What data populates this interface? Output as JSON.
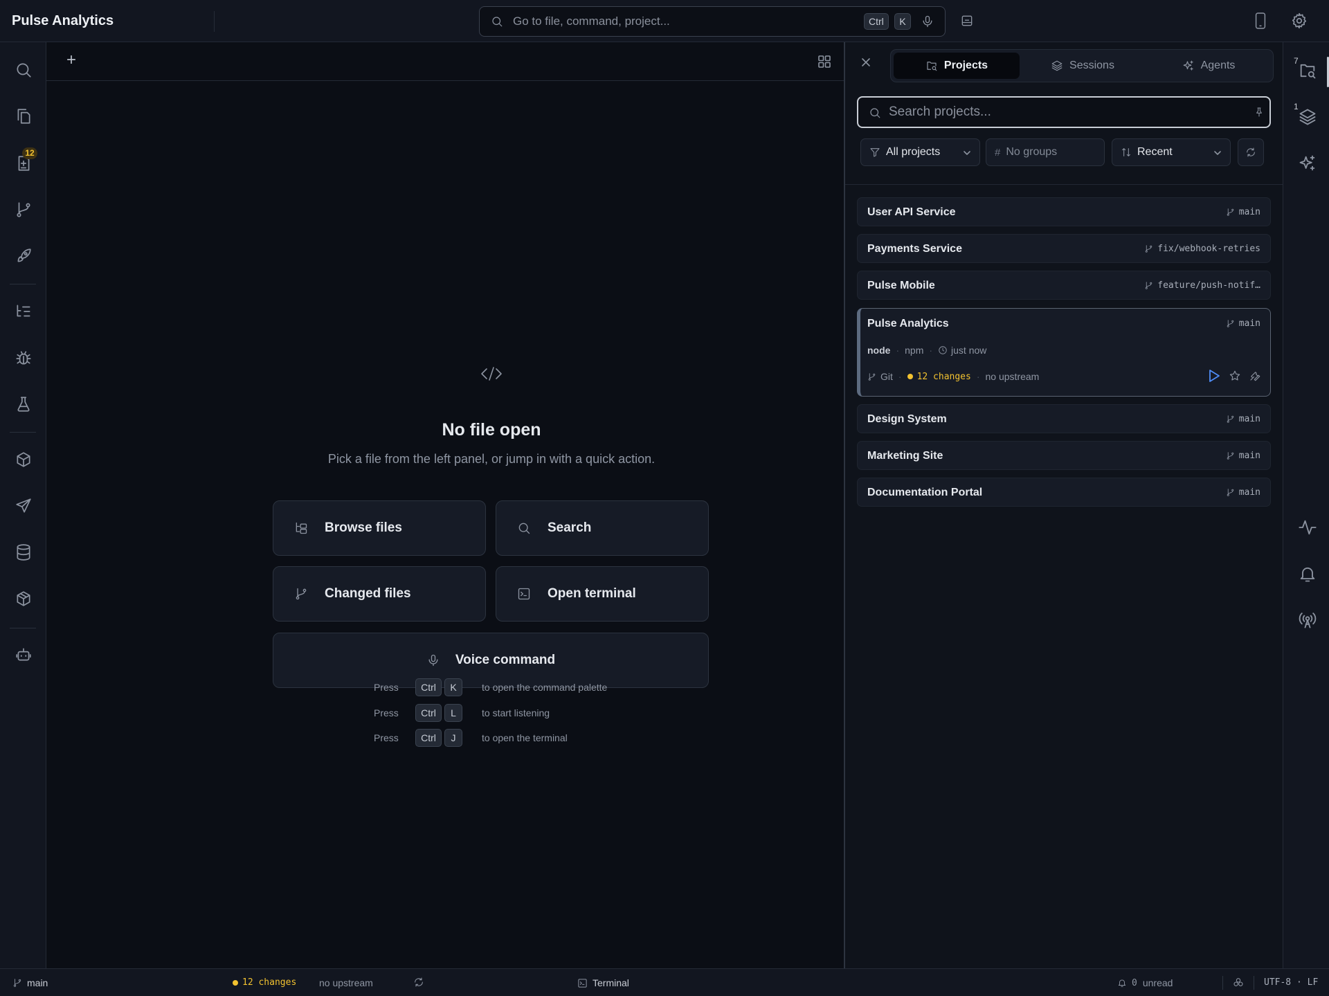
{
  "app": {
    "title": "Pulse Analytics"
  },
  "command_search": {
    "placeholder": "Go to file, command, project...",
    "shortcut_modifier": "Ctrl",
    "shortcut_key": "K"
  },
  "left_activity_bar": {
    "items": [
      {
        "icon": "search-icon"
      },
      {
        "icon": "files-icon"
      },
      {
        "icon": "changes-icon",
        "badge": "12"
      },
      {
        "icon": "git-branch-icon"
      },
      {
        "icon": "rocket-icon"
      },
      {
        "icon": "tasks-icon"
      },
      {
        "icon": "bug-icon"
      },
      {
        "icon": "flask-icon"
      },
      {
        "icon": "package-icon"
      },
      {
        "icon": "send-icon"
      },
      {
        "icon": "database-icon"
      },
      {
        "icon": "box-icon"
      },
      {
        "icon": "bot-icon"
      }
    ]
  },
  "editor": {
    "new_tab_label": "+",
    "empty_state": {
      "title": "No file open",
      "subtitle": "Pick a file from the left panel, or jump in with a quick action."
    },
    "quick_actions": {
      "browse": "Browse files",
      "search": "Search",
      "changed": "Changed files",
      "terminal": "Open terminal",
      "voice": "Voice command"
    },
    "hints": [
      {
        "press": "Press",
        "modifier": "Ctrl",
        "key": "K",
        "text": "to open the command palette"
      },
      {
        "press": "Press",
        "modifier": "Ctrl",
        "key": "L",
        "text": "to start listening"
      },
      {
        "press": "Press",
        "modifier": "Ctrl",
        "key": "J",
        "text": "to open the terminal"
      }
    ]
  },
  "panel": {
    "tabs": [
      {
        "label": "Projects",
        "active": true
      },
      {
        "label": "Sessions",
        "active": false
      },
      {
        "label": "Agents",
        "active": false
      }
    ],
    "search_placeholder": "Search projects...",
    "filters": {
      "scope": "All projects",
      "groups": "No groups",
      "sort": "Recent"
    },
    "projects": [
      {
        "name": "User API Service",
        "branch": "main"
      },
      {
        "name": "Payments Service",
        "branch": "fix/webhook-retries"
      },
      {
        "name": "Pulse Mobile",
        "branch": "feature/push-notif…"
      },
      {
        "name": "Pulse Analytics",
        "branch": "main"
      },
      {
        "name": "Design System",
        "branch": "main"
      },
      {
        "name": "Marketing Site",
        "branch": "main"
      },
      {
        "name": "Documentation Portal",
        "branch": "main"
      }
    ],
    "active_project": {
      "runtime": "node",
      "package_manager": "npm",
      "updated": "just now",
      "vcs": "Git",
      "changes": "12 changes",
      "upstream": "no upstream"
    }
  },
  "right_activity_bar": {
    "items": [
      {
        "icon": "projects-icon",
        "badge": "7"
      },
      {
        "icon": "layers-icon",
        "badge": "1"
      },
      {
        "icon": "sparkles-icon"
      },
      {
        "icon": "activity-icon"
      },
      {
        "icon": "bell-icon"
      },
      {
        "icon": "broadcast-icon"
      }
    ]
  },
  "status_bar": {
    "branch": "main",
    "changes": "12 changes",
    "upstream": "no upstream",
    "terminal": "Terminal",
    "notifications_count": "0",
    "notifications_label": "unread",
    "encoding": "UTF-8 · LF"
  },
  "colors": {
    "background": "#0b0e15",
    "surface": "#161b26",
    "accent_yellow": "#f2c230",
    "run_blue": "#4f8df7"
  }
}
